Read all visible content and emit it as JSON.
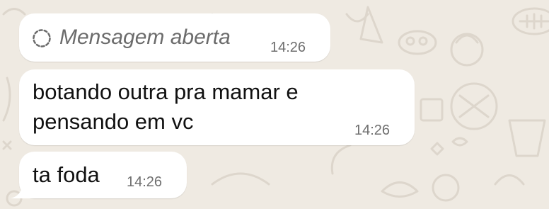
{
  "chat": {
    "wallpaper_color": "#efeae2",
    "bubble_color": "#ffffff",
    "messages": [
      {
        "icon": "view-once-opened-icon",
        "text": "Mensagem aberta",
        "time": "14:26"
      },
      {
        "lines": [
          "botando outra pra mamar e",
          "pensando em vc"
        ],
        "time": "14:26"
      },
      {
        "text": "ta foda",
        "time": "14:26"
      }
    ]
  }
}
